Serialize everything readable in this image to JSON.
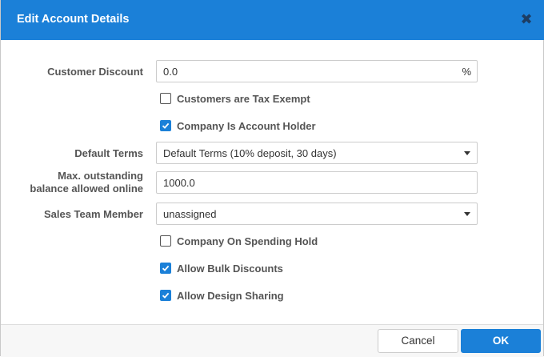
{
  "dialog": {
    "title": "Edit Account Details",
    "close_icon": "close-icon",
    "accent_color": "#1b80d8"
  },
  "form": {
    "discount": {
      "label": "Customer Discount",
      "value": "0.0",
      "suffix": "%"
    },
    "tax_exempt": {
      "label": "Customers are Tax Exempt",
      "checked": false
    },
    "account_holder": {
      "label": "Company Is Account Holder",
      "checked": true
    },
    "default_terms": {
      "label": "Default Terms",
      "value": "Default Terms (10% deposit, 30 days)"
    },
    "max_balance": {
      "label_line1": "Max. outstanding",
      "label_line2": "balance allowed online",
      "value": "1000.0"
    },
    "sales_team": {
      "label": "Sales Team Member",
      "value": "unassigned"
    },
    "spending_hold": {
      "label": "Company On Spending Hold",
      "checked": false
    },
    "bulk_discounts": {
      "label": "Allow Bulk Discounts",
      "checked": true
    },
    "design_sharing": {
      "label": "Allow Design Sharing",
      "checked": true
    }
  },
  "footer": {
    "cancel_label": "Cancel",
    "ok_label": "OK"
  }
}
